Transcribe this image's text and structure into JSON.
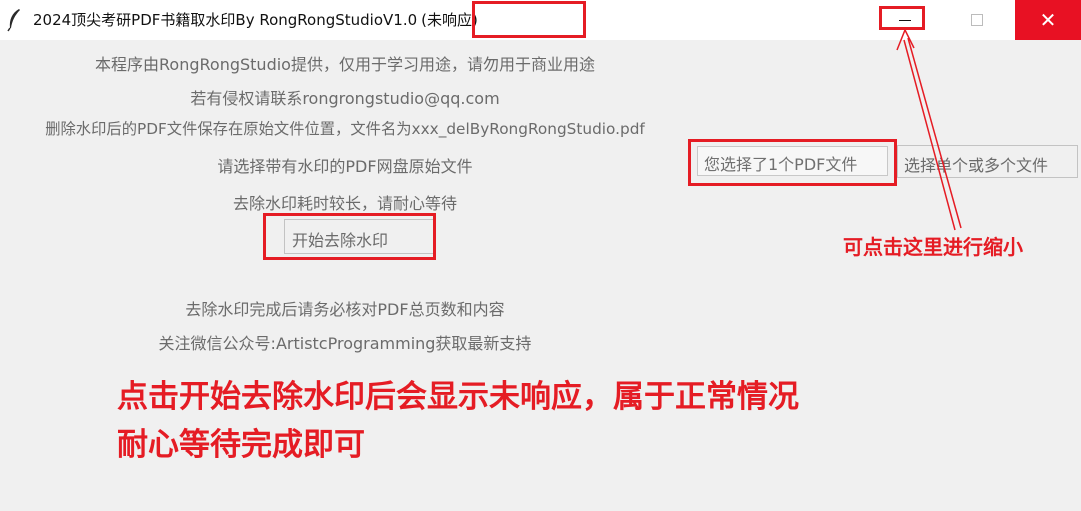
{
  "window": {
    "title": "2024顶尖考研PDF书籍取水印By RongRongStudioV1.0",
    "status": "(未响应)",
    "icon": "feather-icon",
    "close_glyph": "✕"
  },
  "info": {
    "line1": "本程序由RongRongStudio提供，仅用于学习用途，请勿用于商业用途",
    "line2": "若有侵权请联系rongrongstudio@qq.com",
    "line3": "删除水印后的PDF文件保存在原始文件位置，文件名为xxx_delByRongRongStudio.pdf",
    "select_label": "请选择带有水印的PDF网盘原始文件",
    "wait_label": "去除水印耗时较长，请耐心等待",
    "after_label": "去除水印完成后请务必核对PDF总页数和内容",
    "follow_label": "关注微信公众号:ArtistcProgramming获取最新支持"
  },
  "file_entry": {
    "value": "您选择了1个PDF文件"
  },
  "buttons": {
    "select_files": "选择单个或多个文件",
    "start": "开始去除水印"
  },
  "annotations": {
    "minimize_hint": "可点击这里进行缩小",
    "note_line1": "点击开始去除水印后会显示未响应，属于正常情况",
    "note_line2": "耐心等待完成即可",
    "color": "#e51c24"
  }
}
